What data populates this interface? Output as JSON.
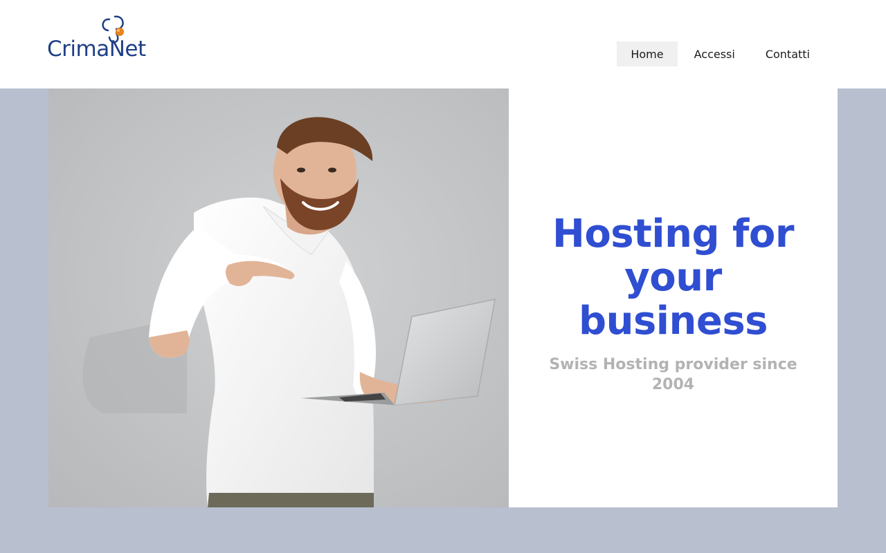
{
  "header": {
    "logo": {
      "text": "CrimaNet",
      "brand_color": "#1f3f86",
      "accent_color": "#e8841a"
    },
    "nav": [
      {
        "label": "Home",
        "active": true
      },
      {
        "label": "Accessi",
        "active": false
      },
      {
        "label": "Contatti",
        "active": false
      }
    ]
  },
  "hero": {
    "image": {
      "description_icon": "man-with-laptop-photo"
    },
    "title": "Hosting for your business",
    "subtitle": "Swiss Hosting provider since 2004",
    "title_color": "#2f4ed1",
    "subtitle_color": "#b3b3b3"
  },
  "colors": {
    "band": "#b8bfcf",
    "nav_active_bg": "#f0f0f0"
  }
}
